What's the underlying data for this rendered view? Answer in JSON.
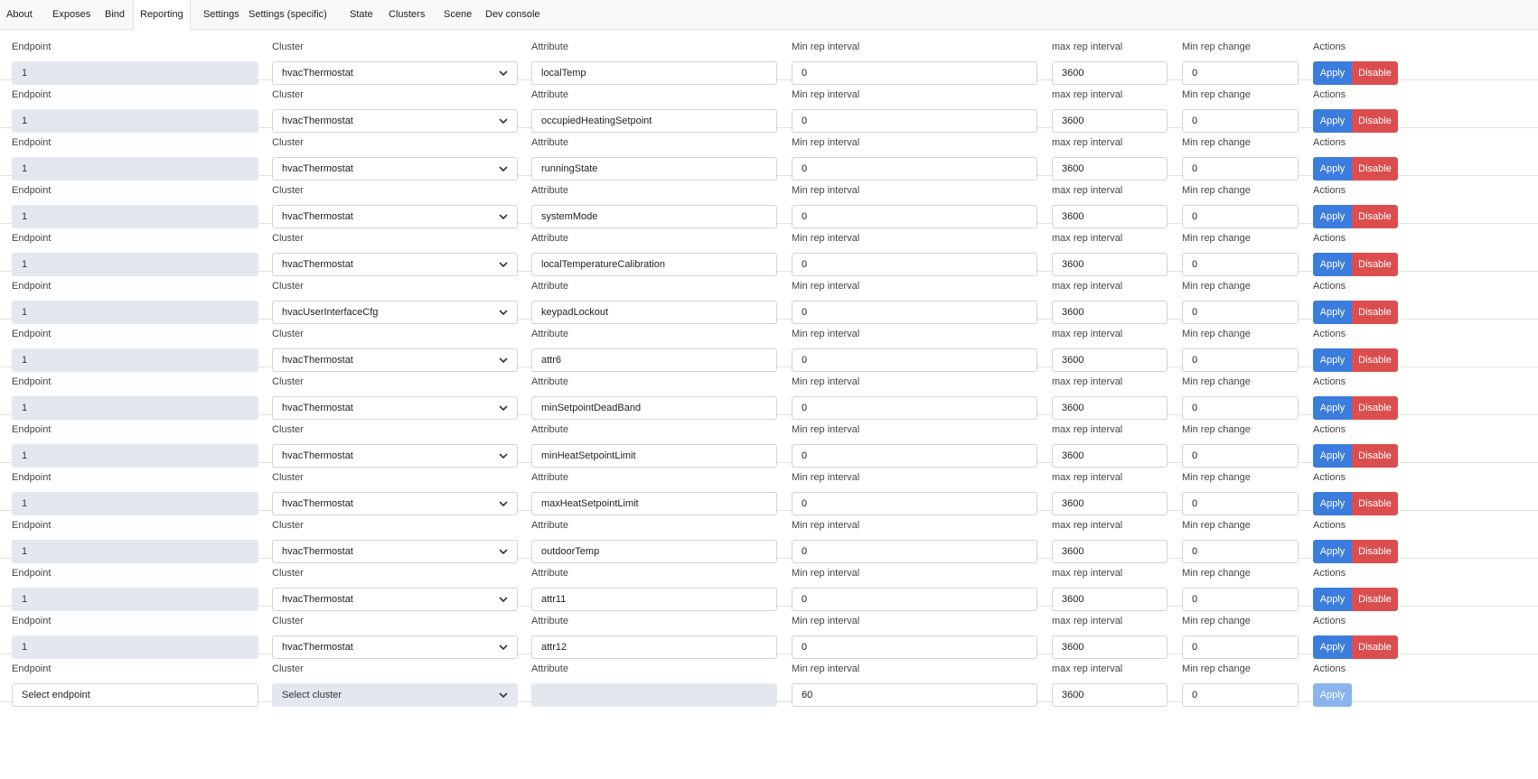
{
  "tabs": [
    {
      "label": "About"
    },
    {
      "label": "Exposes"
    },
    {
      "label": "Bind"
    },
    {
      "label": "Reporting",
      "active": true
    },
    {
      "label": "Settings"
    },
    {
      "label": "Settings (specific)"
    },
    {
      "label": "State"
    },
    {
      "label": "Clusters"
    },
    {
      "label": "Scene"
    },
    {
      "label": "Dev console"
    }
  ],
  "labels": {
    "endpoint": "Endpoint",
    "cluster": "Cluster",
    "attribute": "Attribute",
    "min_rep_interval": "Min rep interval",
    "max_rep_interval": "max rep interval",
    "min_rep_change": "Min rep change",
    "actions": "Actions"
  },
  "buttons": {
    "apply": "Apply",
    "disable": "Disable"
  },
  "rows": [
    {
      "endpoint": "1",
      "cluster": "hvacThermostat",
      "attribute": "localTemp",
      "min_rep_interval": "0",
      "max_rep_interval": "3600",
      "min_rep_change": "0"
    },
    {
      "endpoint": "1",
      "cluster": "hvacThermostat",
      "attribute": "occupiedHeatingSetpoint",
      "min_rep_interval": "0",
      "max_rep_interval": "3600",
      "min_rep_change": "0"
    },
    {
      "endpoint": "1",
      "cluster": "hvacThermostat",
      "attribute": "runningState",
      "min_rep_interval": "0",
      "max_rep_interval": "3600",
      "min_rep_change": "0"
    },
    {
      "endpoint": "1",
      "cluster": "hvacThermostat",
      "attribute": "systemMode",
      "min_rep_interval": "0",
      "max_rep_interval": "3600",
      "min_rep_change": "0"
    },
    {
      "endpoint": "1",
      "cluster": "hvacThermostat",
      "attribute": "localTemperatureCalibration",
      "min_rep_interval": "0",
      "max_rep_interval": "3600",
      "min_rep_change": "0"
    },
    {
      "endpoint": "1",
      "cluster": "hvacUserInterfaceCfg",
      "attribute": "keypadLockout",
      "min_rep_interval": "0",
      "max_rep_interval": "3600",
      "min_rep_change": "0"
    },
    {
      "endpoint": "1",
      "cluster": "hvacThermostat",
      "attribute": "attr6",
      "min_rep_interval": "0",
      "max_rep_interval": "3600",
      "min_rep_change": "0"
    },
    {
      "endpoint": "1",
      "cluster": "hvacThermostat",
      "attribute": "minSetpointDeadBand",
      "min_rep_interval": "0",
      "max_rep_interval": "3600",
      "min_rep_change": "0"
    },
    {
      "endpoint": "1",
      "cluster": "hvacThermostat",
      "attribute": "minHeatSetpointLimit",
      "min_rep_interval": "0",
      "max_rep_interval": "3600",
      "min_rep_change": "0"
    },
    {
      "endpoint": "1",
      "cluster": "hvacThermostat",
      "attribute": "maxHeatSetpointLimit",
      "min_rep_interval": "0",
      "max_rep_interval": "3600",
      "min_rep_change": "0"
    },
    {
      "endpoint": "1",
      "cluster": "hvacThermostat",
      "attribute": "outdoorTemp",
      "min_rep_interval": "0",
      "max_rep_interval": "3600",
      "min_rep_change": "0"
    },
    {
      "endpoint": "1",
      "cluster": "hvacThermostat",
      "attribute": "attr11",
      "min_rep_interval": "0",
      "max_rep_interval": "3600",
      "min_rep_change": "0"
    },
    {
      "endpoint": "1",
      "cluster": "hvacThermostat",
      "attribute": "attr12",
      "min_rep_interval": "0",
      "max_rep_interval": "3600",
      "min_rep_change": "0"
    }
  ],
  "new_row": {
    "endpoint": "Select endpoint",
    "cluster": "Select cluster",
    "attribute": "",
    "min_rep_interval": "60",
    "max_rep_interval": "3600",
    "min_rep_change": "0"
  },
  "colors": {
    "apply": "#3b7ddd",
    "apply_disabled": "#8ab4ec",
    "disable": "#dc4e4e",
    "readonly_field": "#e4e8ee",
    "tab_bar": "#f7f8fa"
  }
}
